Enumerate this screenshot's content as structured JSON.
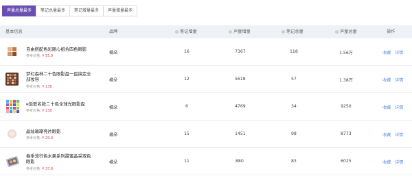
{
  "tabs": [
    {
      "label": "声量总量最多",
      "active": true
    },
    {
      "label": "笔记总量最多",
      "active": false
    },
    {
      "label": "笔记增量最多",
      "active": false
    },
    {
      "label": "声量增量最多",
      "active": false
    }
  ],
  "columns": {
    "basic_info": "基本信息",
    "brand": "品牌",
    "note_growth": "笔记增量",
    "voice_growth": "声量增量",
    "note_total": "笔记总量",
    "voice_total": "声量总量",
    "actions": "操作"
  },
  "reference_label": "参考价格:",
  "actions": {
    "favorite": "收藏",
    "details": "详情"
  },
  "rows": [
    {
      "name": "自由搭配色彩随心组合四色眼影",
      "price": "¥ 55.9",
      "brand": "橘朵",
      "note_growth": "16",
      "voice_growth": "7367",
      "note_total": "118",
      "voice_total": "1.56万",
      "thumb": "four-square-eyeshadow"
    },
    {
      "name": "梦幻森林二十色眼影盘一盘搞定全部妆容",
      "price": "¥ 138",
      "brand": "橘朵",
      "note_growth": "12",
      "voice_growth": "5618",
      "note_total": "57",
      "voice_total": "1.38万",
      "thumb": "twenty-color-palette"
    },
    {
      "name": "e饭联名款二十色全球光眼影盘",
      "price": "¥ 138",
      "brand": "橘朵",
      "note_growth": "6",
      "voice_growth": "4769",
      "note_total": "34",
      "voice_total": "9250",
      "thumb": "colorful-palette"
    },
    {
      "name": "晶灿璀璨亮片眼影",
      "price": "¥ 29.9",
      "brand": "橘朵",
      "note_growth": "15",
      "voice_growth": "1451",
      "note_total": "98",
      "voice_total": "8773",
      "thumb": "single-glitter-pan"
    },
    {
      "name": "春季流行色水果系列甜蜜晶采双色眼影",
      "price": "¥ 37.8",
      "brand": "橘朵",
      "note_growth": "11",
      "voice_growth": "880",
      "note_total": "83",
      "voice_total": "6025",
      "thumb": "duo-compact"
    }
  ],
  "colors": {
    "accent": "#6a4fb3",
    "price": "#e5484d",
    "link": "#5b8def",
    "header_bg": "#eef2f7"
  }
}
